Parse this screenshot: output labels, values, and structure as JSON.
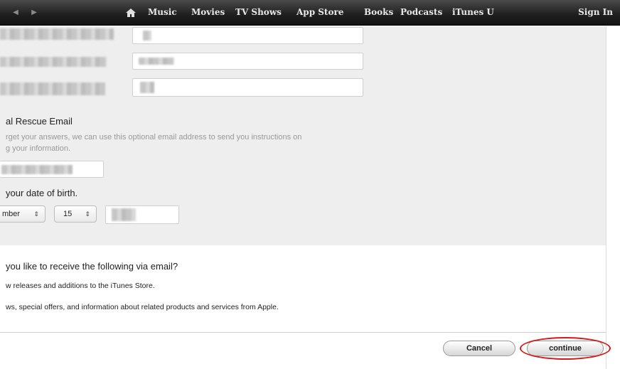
{
  "nav": {
    "back_icon": "left-arrow-icon",
    "forward_icon": "right-arrow-icon",
    "home_icon": "home-icon",
    "items": [
      "Music",
      "Movies",
      "TV Shows",
      "App Store",
      "Books",
      "Podcasts",
      "iTunes U"
    ],
    "sign_in": "Sign In"
  },
  "rescue": {
    "title": "al Rescue Email",
    "hint_line1": "rget your answers, we can use this optional email address to send you instructions on",
    "hint_line2": "g your information."
  },
  "dob": {
    "title": "your date of birth.",
    "month": "mber",
    "day": "15",
    "select_arrow": "⇕"
  },
  "email_prefs": {
    "question": "you like to receive the following via email?",
    "option1": "w releases and additions to the iTunes Store.",
    "option2": "ws, special offers, and information about related products and services from Apple."
  },
  "actions": {
    "cancel": "Cancel",
    "continue": "continue"
  }
}
